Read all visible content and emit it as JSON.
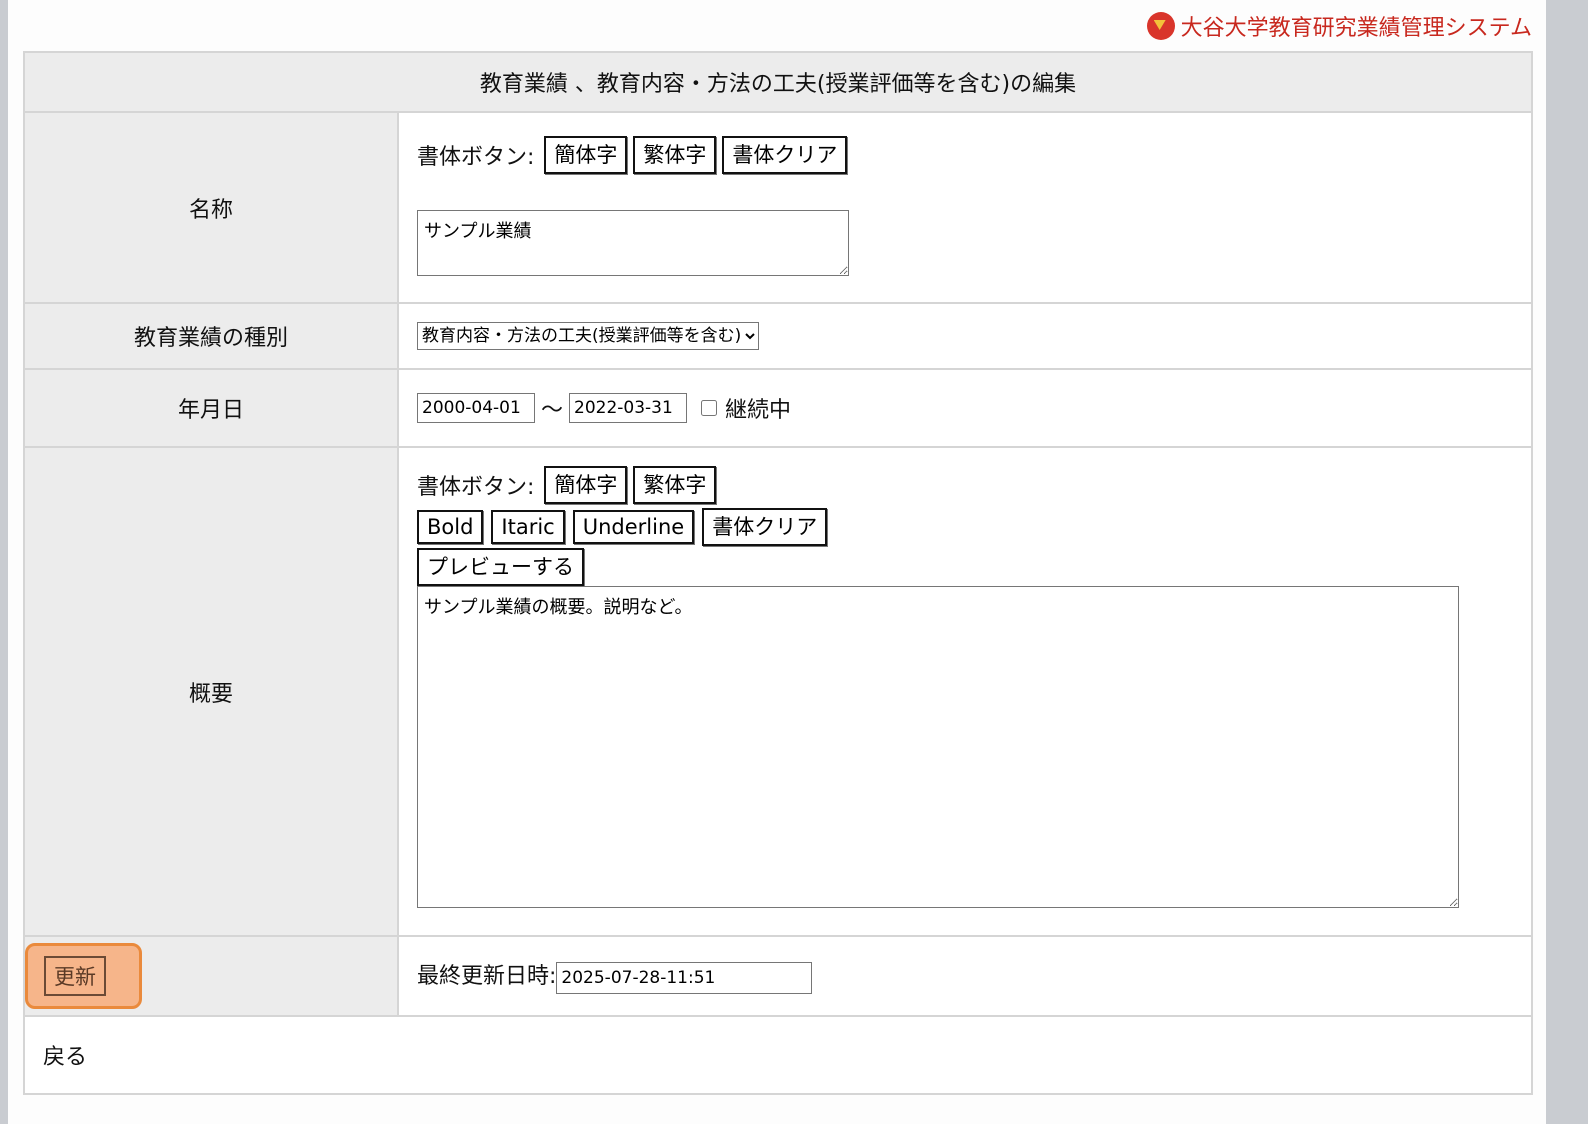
{
  "brand": {
    "name": "大谷大学教育研究業績管理システム"
  },
  "form": {
    "title": "教育業績 、教育内容・方法の工夫(授業評価等を含む)の編集",
    "name": {
      "label": "名称",
      "toolbar_label": "書体ボタン:",
      "buttons": [
        "簡体字",
        "繁体字",
        "書体クリア"
      ],
      "value": "サンプル業績"
    },
    "kind": {
      "label": "教育業績の種別",
      "selected": "教育内容・方法の工夫(授業評価等を含む)"
    },
    "date": {
      "label": "年月日",
      "start": "2000-04-01",
      "separator": "〜",
      "end": "2022-03-31",
      "ongoing_label": "継続中",
      "ongoing_checked": false
    },
    "summary": {
      "label": "概要",
      "toolbar_label": "書体ボタン:",
      "buttons_row1": [
        "簡体字",
        "繁体字"
      ],
      "buttons_row2": [
        "Bold",
        "Itaric",
        "Underline",
        "書体クリア"
      ],
      "preview_label": "プレビューする",
      "value": "サンプル業績の概要。説明など。"
    },
    "footer": {
      "update_label": "更新",
      "last_updated_label": "最終更新日時:",
      "last_updated_value": "2025-07-28-11:51"
    },
    "back_label": "戻る"
  },
  "colors": {
    "brand": "#c8281e",
    "label_bg": "#ececec",
    "highlight_border": "#ea8a3c",
    "highlight_fill": "#f6b58a"
  }
}
